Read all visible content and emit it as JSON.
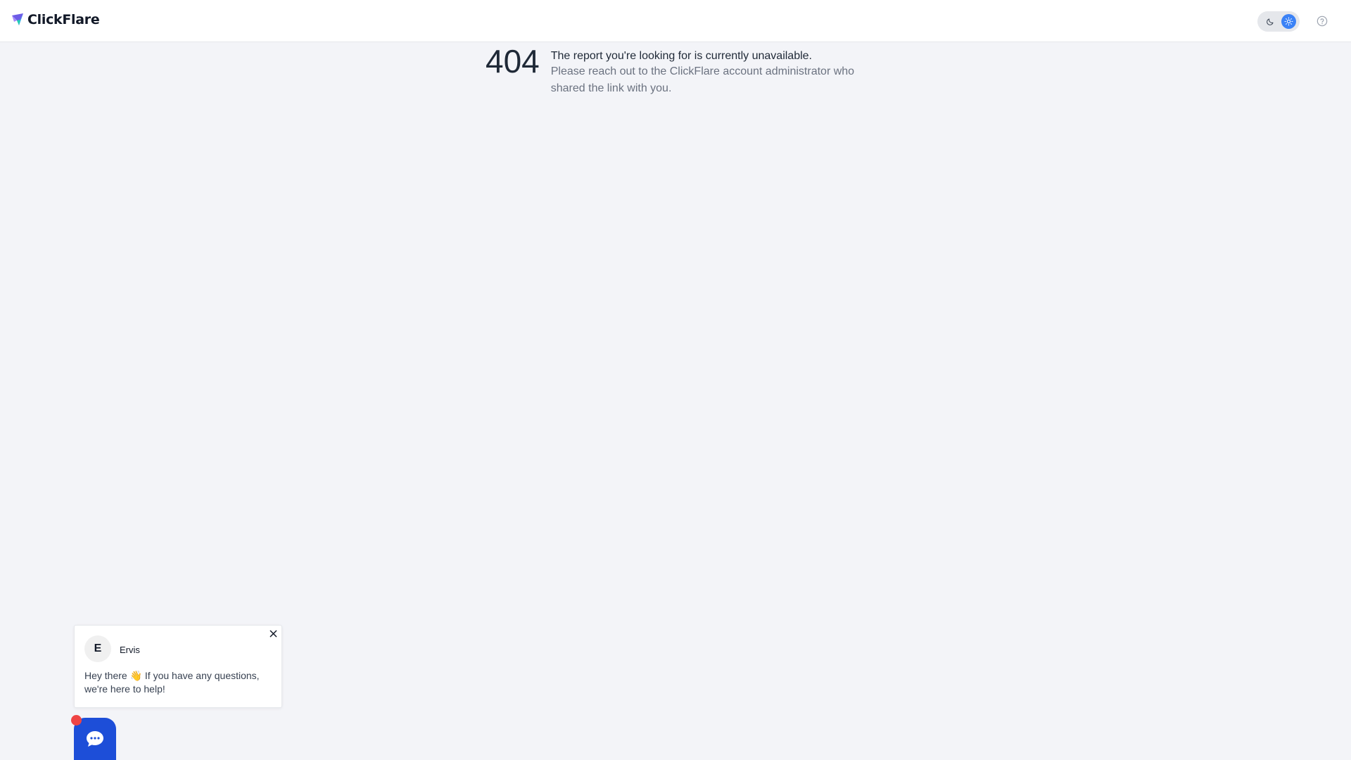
{
  "header": {
    "brand": "ClickFlare",
    "logo_icon": "paper-plane-flag-logo",
    "theme_toggle": {
      "dark_icon": "moon-icon",
      "light_icon": "sun-icon",
      "active": "light",
      "active_color": "#3b82f6"
    },
    "help_icon": "question-circle-icon"
  },
  "error": {
    "code": "404",
    "title": "The report you're looking for is currently unavailable.",
    "description": "Please reach out to the ClickFlare account administrator who shared the link with you."
  },
  "chat": {
    "agent_initial": "E",
    "agent_name": "Ervis",
    "message": "Hey there 👋 If you have any questions, we're here to help!",
    "close_icon": "close-icon",
    "launcher_icon": "chat-bubble-icon",
    "launcher_color": "#1d4ed8",
    "badge_color": "#ef4444"
  }
}
